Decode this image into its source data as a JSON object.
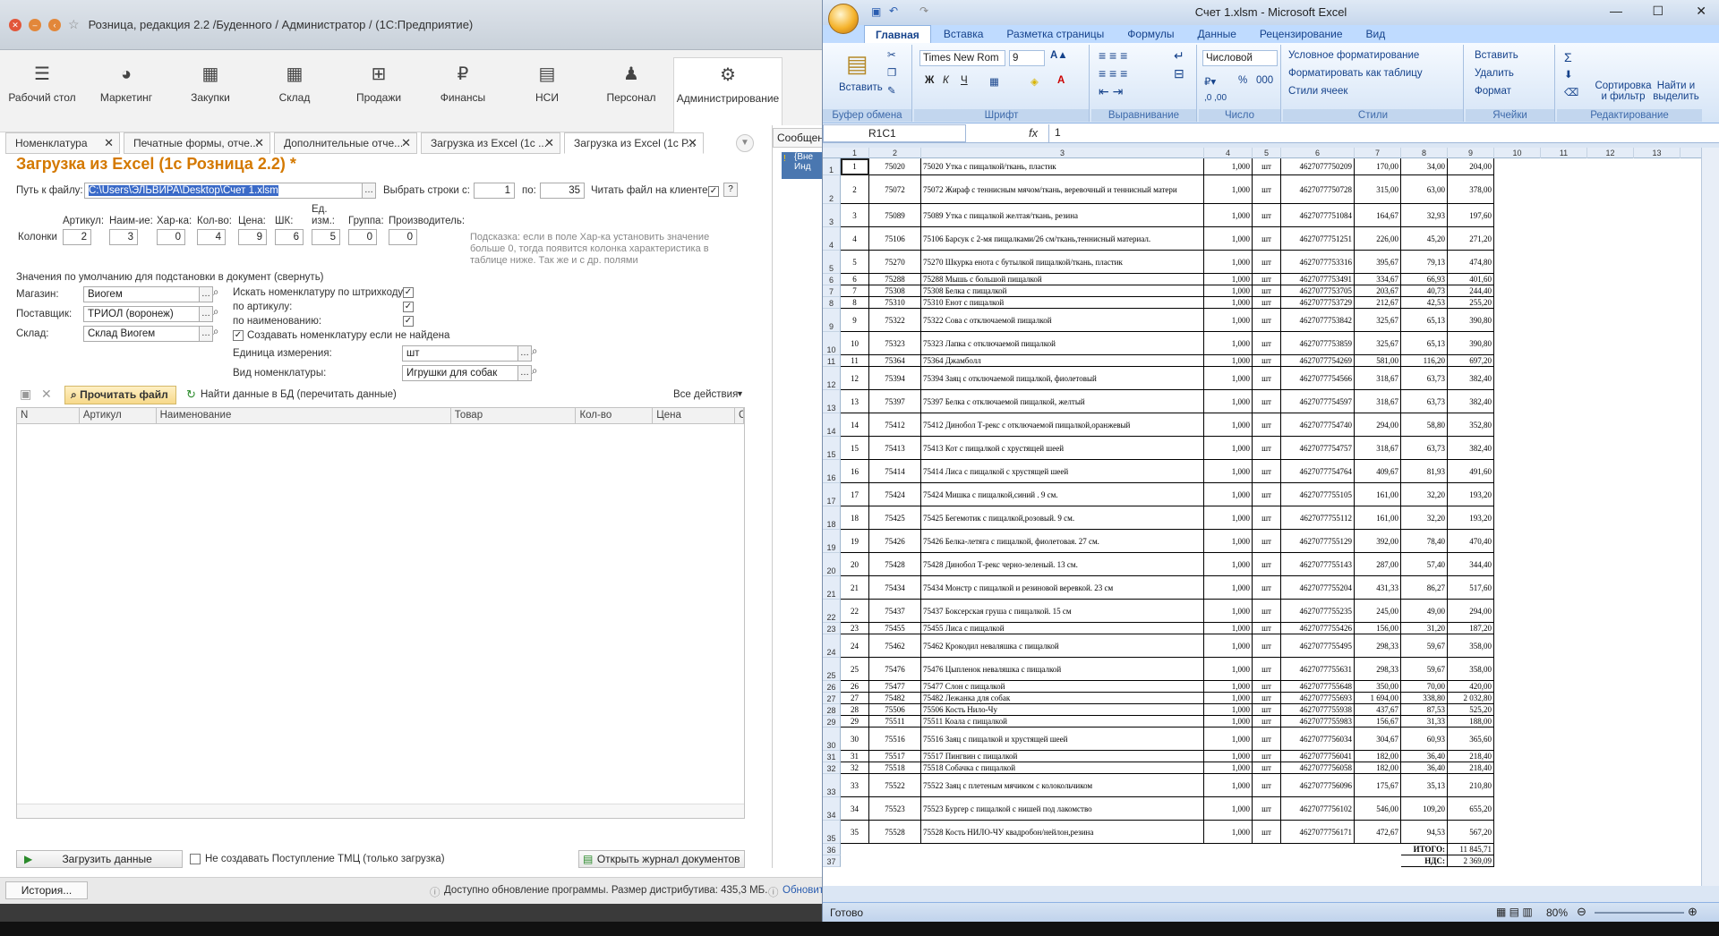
{
  "onec": {
    "window_title": "Розница, редакция 2.2 /Буденного / Администратор / (1С:Предприятие)",
    "sections": [
      {
        "label": "Рабочий стол",
        "icon": "menu-icon"
      },
      {
        "label": "Маркетинг",
        "icon": "pie-icon"
      },
      {
        "label": "Закупки",
        "icon": "cart-icon"
      },
      {
        "label": "Склад",
        "icon": "grid-icon"
      },
      {
        "label": "Продажи",
        "icon": "basket-icon"
      },
      {
        "label": "Финансы",
        "icon": "ruble-icon"
      },
      {
        "label": "НСИ",
        "icon": "book-icon"
      },
      {
        "label": "Персонал",
        "icon": "person-icon"
      },
      {
        "label": "Администрирование",
        "icon": "gear-icon"
      }
    ],
    "tabs": [
      {
        "label": "Номенклатура"
      },
      {
        "label": "Печатные формы, отче..."
      },
      {
        "label": "Дополнительные отче..."
      },
      {
        "label": "Загрузка из Excel (1с ..."
      },
      {
        "label": "Загрузка из Excel (1с Р..."
      }
    ],
    "messages_tab": "Сообщен",
    "messages_text": "{Вне Инд",
    "form": {
      "title": "Загрузка из Excel (1с Розница 2.2) *",
      "path_label": "Путь к файлу:",
      "path_value": "C:\\Users\\ЭЛЬВИРА\\Desktop\\Счет 1.xlsm",
      "rows_from_label": "Выбрать строки с:",
      "rows_from": "1",
      "rows_to_label": "по:",
      "rows_to": "35",
      "read_on_client_label": "Читать файл на клиенте:",
      "help_label": "?",
      "columns_label": "Колонки",
      "col_fields": [
        {
          "label": "Артикул:",
          "value": "2"
        },
        {
          "label": "Наим-ие:",
          "value": "3"
        },
        {
          "label": "Хар-ка:",
          "value": "0"
        },
        {
          "label": "Кол-во:",
          "value": "4"
        },
        {
          "label": "Цена:",
          "value": "9"
        },
        {
          "label": "ШК:",
          "value": "6"
        },
        {
          "label": "Ед. изм.:",
          "value": "5"
        },
        {
          "label": "Группа:",
          "value": "0"
        },
        {
          "label": "Производитель:",
          "value": "0"
        }
      ],
      "hint": "Подсказка: если в поле Хар-ка установить значение больше 0, тогда появится колонка характеристика в таблице ниже. Так же и с др. полями",
      "defaults_header": "Значения по умолчанию для подстановки в документ (свернуть)",
      "store_label": "Магазин:",
      "store_value": "Виогем",
      "supplier_label": "Поставщик:",
      "supplier_value": "ТРИОЛ (воронеж)",
      "warehouse_label": "Склад:",
      "warehouse_value": "Склад Виогем",
      "search_barcode_label": "Искать номенклатуру по штрихкоду:",
      "search_article_label": "по артикулу:",
      "search_name_label": "по наименованию:",
      "create_if_missing_label": "Создавать номенклатуру если не найдена",
      "unit_label": "Единица измерения:",
      "unit_value": "шт",
      "kind_label": "Вид номенклатуры:",
      "kind_value": "Игрушки для собак",
      "read_file_button": "Прочитать файл",
      "find_data_button": "Найти данные в БД (перечитать данные)",
      "all_actions": "Все действия",
      "grid_columns": [
        "N",
        "Артикул",
        "Наименование",
        "Товар",
        "Кол-во",
        "Цена",
        "Су"
      ],
      "load_button": "Загрузить данные",
      "no_receipt_label": "Не создавать Поступление ТМЦ (только загрузка)",
      "open_journal_button": "Открыть журнал документов"
    },
    "history_button": "История...",
    "update_status": "Доступно обновление программы. Размер дистрибутива: 435,3 МБ.",
    "update_link": "Обновит"
  },
  "excel": {
    "title": "Счет 1.xlsm - Microsoft Excel",
    "tabs": [
      "Главная",
      "Вставка",
      "Разметка страницы",
      "Формулы",
      "Данные",
      "Рецензирование",
      "Вид"
    ],
    "groups": {
      "clipboard": "Буфер обмена",
      "font": "Шрифт",
      "alignment": "Выравнивание",
      "number": "Число",
      "styles": "Стили",
      "cells": "Ячейки",
      "editing": "Редактирование"
    },
    "paste_label": "Вставить",
    "font_name": "Times New Rom",
    "font_size": "9",
    "number_format": "Числовой",
    "conditional_format": "Условное форматирование",
    "format_as_table": "Форматировать как таблицу",
    "cell_styles": "Стили ячеек",
    "insert_label": "Вставить",
    "delete_label": "Удалить",
    "format_label": "Формат",
    "sort_filter": "Сортировка и фильтр",
    "find_select": "Найти и выделить",
    "name_box": "R1C1",
    "formula_value": "1",
    "col_headers": [
      "1",
      "2",
      "3",
      "4",
      "5",
      "6",
      "7",
      "8",
      "9",
      "10",
      "11",
      "12",
      "13"
    ],
    "rows": [
      [
        "1",
        "75020",
        "75020 Утка с пищалкой/ткань, пластик",
        "1,000",
        "шт",
        "4627077750209",
        "170,00",
        "34,00",
        "204,00"
      ],
      [
        "2",
        "75072",
        "75072 Жираф с теннисным мячом/ткань, веревочный и теннисный матери",
        "1,000",
        "шт",
        "4627077750728",
        "315,00",
        "63,00",
        "378,00"
      ],
      [
        "3",
        "75089",
        "75089 Утка с пищалкой желтая/ткань, резина",
        "1,000",
        "шт",
        "4627077751084",
        "164,67",
        "32,93",
        "197,60"
      ],
      [
        "4",
        "75106",
        "75106 Барсук с 2-мя пищалками/26 см/ткань,теннисный материал.",
        "1,000",
        "шт",
        "4627077751251",
        "226,00",
        "45,20",
        "271,20"
      ],
      [
        "5",
        "75270",
        "75270 Шкурка енота с бутылкой пищалкой/ткань, пластик",
        "1,000",
        "шт",
        "4627077753316",
        "395,67",
        "79,13",
        "474,80"
      ],
      [
        "6",
        "75288",
        "75288 Мышь с большой пищалкой",
        "1,000",
        "шт",
        "4627077753491",
        "334,67",
        "66,93",
        "401,60"
      ],
      [
        "7",
        "75308",
        "75308 Белка с пищалкой",
        "1,000",
        "шт",
        "4627077753705",
        "203,67",
        "40,73",
        "244,40"
      ],
      [
        "8",
        "75310",
        "75310 Енот с пищалкой",
        "1,000",
        "шт",
        "4627077753729",
        "212,67",
        "42,53",
        "255,20"
      ],
      [
        "9",
        "75322",
        "75322 Сова с отключаемой пищалкой",
        "1,000",
        "шт",
        "4627077753842",
        "325,67",
        "65,13",
        "390,80"
      ],
      [
        "10",
        "75323",
        "75323 Лапка с отключаемой пищалкой",
        "1,000",
        "шт",
        "4627077753859",
        "325,67",
        "65,13",
        "390,80"
      ],
      [
        "11",
        "75364",
        "75364 Джамболл",
        "1,000",
        "шт",
        "4627077754269",
        "581,00",
        "116,20",
        "697,20"
      ],
      [
        "12",
        "75394",
        "75394 Заяц с отключаемой пищалкой, фиолетовый",
        "1,000",
        "шт",
        "4627077754566",
        "318,67",
        "63,73",
        "382,40"
      ],
      [
        "13",
        "75397",
        "75397 Белка с отключаемой пищалкой, желтый",
        "1,000",
        "шт",
        "4627077754597",
        "318,67",
        "63,73",
        "382,40"
      ],
      [
        "14",
        "75412",
        "75412 Динобол Т-рекс с отключаемой пищалкой,оранжевый",
        "1,000",
        "шт",
        "4627077754740",
        "294,00",
        "58,80",
        "352,80"
      ],
      [
        "15",
        "75413",
        "75413 Кот с пищалкой с хрустящей шеей",
        "1,000",
        "шт",
        "4627077754757",
        "318,67",
        "63,73",
        "382,40"
      ],
      [
        "16",
        "75414",
        "75414 Лиса с пищалкой с хрустящей шеей",
        "1,000",
        "шт",
        "4627077754764",
        "409,67",
        "81,93",
        "491,60"
      ],
      [
        "17",
        "75424",
        "75424 Мишка с пищалкой,синий . 9 см.",
        "1,000",
        "шт",
        "4627077755105",
        "161,00",
        "32,20",
        "193,20"
      ],
      [
        "18",
        "75425",
        "75425 Бегемотик  с пищалкой,розовый. 9 см.",
        "1,000",
        "шт",
        "4627077755112",
        "161,00",
        "32,20",
        "193,20"
      ],
      [
        "19",
        "75426",
        "75426 Белка-летяга с пищалкой, фиолетовая. 27 см.",
        "1,000",
        "шт",
        "4627077755129",
        "392,00",
        "78,40",
        "470,40"
      ],
      [
        "20",
        "75428",
        "75428 Динобол Т-рекс черно-зеленый. 13 см.",
        "1,000",
        "шт",
        "4627077755143",
        "287,00",
        "57,40",
        "344,40"
      ],
      [
        "21",
        "75434",
        "75434 Монстр с пищалкой и резиновой веревкой. 23 см",
        "1,000",
        "шт",
        "4627077755204",
        "431,33",
        "86,27",
        "517,60"
      ],
      [
        "22",
        "75437",
        "75437 Боксерская груша с пищалкой. 15 см",
        "1,000",
        "шт",
        "4627077755235",
        "245,00",
        "49,00",
        "294,00"
      ],
      [
        "23",
        "75455",
        "75455 Лиса с пищалкой",
        "1,000",
        "шт",
        "4627077755426",
        "156,00",
        "31,20",
        "187,20"
      ],
      [
        "24",
        "75462",
        "75462 Крокодил неваляшка с пищалкой",
        "1,000",
        "шт",
        "4627077755495",
        "298,33",
        "59,67",
        "358,00"
      ],
      [
        "25",
        "75476",
        "75476 Цыпленок неваляшка с пищалкой",
        "1,000",
        "шт",
        "4627077755631",
        "298,33",
        "59,67",
        "358,00"
      ],
      [
        "26",
        "75477",
        "75477 Слон с пищалкой",
        "1,000",
        "шт",
        "4627077755648",
        "350,00",
        "70,00",
        "420,00"
      ],
      [
        "27",
        "75482",
        "75482 Лежанка для собак",
        "1,000",
        "шт",
        "4627077755693",
        "1 694,00",
        "338,80",
        "2 032,80"
      ],
      [
        "28",
        "75506",
        "75506 Кость Нило-Чу",
        "1,000",
        "шт",
        "4627077755938",
        "437,67",
        "87,53",
        "525,20"
      ],
      [
        "29",
        "75511",
        "75511 Коала с пищалкой",
        "1,000",
        "шт",
        "4627077755983",
        "156,67",
        "31,33",
        "188,00"
      ],
      [
        "30",
        "75516",
        "75516 Заяц с пищалкой и хрустящей шеей",
        "1,000",
        "шт",
        "4627077756034",
        "304,67",
        "60,93",
        "365,60"
      ],
      [
        "31",
        "75517",
        "75517 Пингвин с пищалкой",
        "1,000",
        "шт",
        "4627077756041",
        "182,00",
        "36,40",
        "218,40"
      ],
      [
        "32",
        "75518",
        "75518 Собачка с пищалкой",
        "1,000",
        "шт",
        "4627077756058",
        "182,00",
        "36,40",
        "218,40"
      ],
      [
        "33",
        "75522",
        "75522 Заяц с плетеным мячиком с колокольчиком",
        "1,000",
        "шт",
        "4627077756096",
        "175,67",
        "35,13",
        "210,80"
      ],
      [
        "34",
        "75523",
        "75523 Бургер с пищалкой с нишей под лакомство",
        "1,000",
        "шт",
        "4627077756102",
        "546,00",
        "109,20",
        "655,20"
      ],
      [
        "35",
        "75528",
        "75528 Кость НИЛО-ЧУ квадробон/нейлон,резина",
        "1,000",
        "шт",
        "4627077756171",
        "472,67",
        "94,53",
        "567,20"
      ]
    ],
    "totals": [
      {
        "label": "ИТОГО:",
        "value": "11 845,71"
      },
      {
        "label": "НДС:",
        "value": "2 369,09"
      }
    ],
    "status_text": "Готово",
    "zoom": "80%"
  }
}
